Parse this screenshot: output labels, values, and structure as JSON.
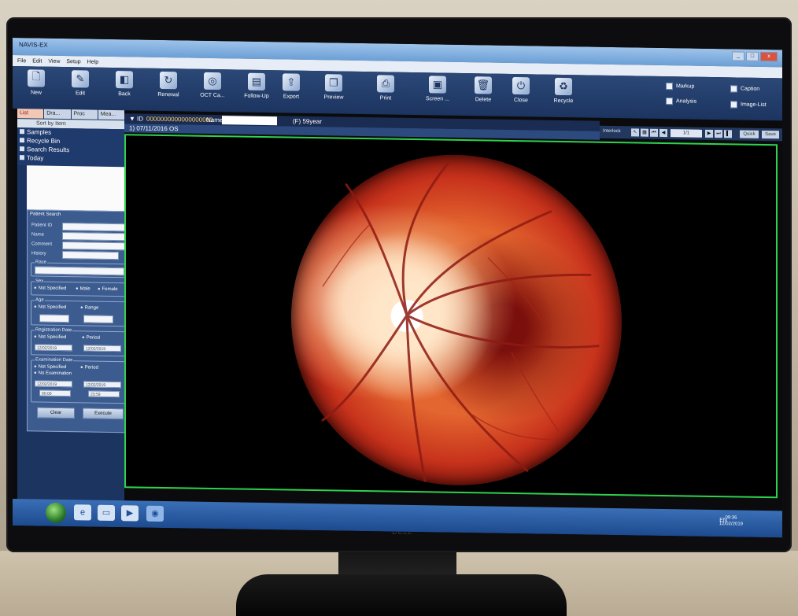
{
  "app": {
    "title": "NAVIS-EX"
  },
  "window_buttons": {
    "minimize": "_",
    "maximize": "□",
    "close": "x"
  },
  "menu": [
    "File",
    "Edit",
    "View",
    "Setup",
    "Help"
  ],
  "toolbar": [
    {
      "label": "New",
      "icon": "new-document-icon"
    },
    {
      "label": "Edit",
      "icon": "edit-icon"
    },
    {
      "label": "Back",
      "icon": "back-icon"
    },
    {
      "label": "Renewal",
      "icon": "renewal-icon"
    },
    {
      "label": "OCT Ca...",
      "icon": "oct-camera-icon"
    },
    {
      "label": "Follow-Up",
      "icon": "follow-up-icon"
    },
    {
      "label": "Export",
      "icon": "export-icon"
    },
    {
      "label": "Preview",
      "icon": "preview-icon"
    },
    {
      "label": "Print",
      "icon": "printer-icon"
    },
    {
      "label": "Screen ...",
      "icon": "screen-icon"
    },
    {
      "label": "Delete",
      "icon": "trash-icon"
    },
    {
      "label": "Close",
      "icon": "power-icon"
    },
    {
      "label": "Recycle",
      "icon": "recycle-icon"
    }
  ],
  "toolbar_options": [
    "Markup",
    "Caption",
    "Analysis",
    "Image-List"
  ],
  "sidebar": {
    "tabs": [
      "List",
      "Dra...",
      "Proc",
      "Mea..."
    ],
    "sort_label": "Sort by Item",
    "tree": [
      "Samples",
      "Recycle Bin",
      "Search Results",
      "Today"
    ]
  },
  "patient_search": {
    "title": "Patient Search",
    "fields": [
      "Patient ID",
      "Name",
      "Comment",
      "History"
    ],
    "race_label": "Race",
    "sex": {
      "label": "Sex",
      "options": [
        "Not Specified",
        "Male",
        "Female"
      ]
    },
    "age": {
      "label": "Age",
      "options": [
        "Not Specified",
        "Range"
      ]
    },
    "registration": {
      "label": "Registration Date",
      "options": [
        "Not Specified",
        "Period"
      ],
      "from": "12/02/2019",
      "to": "12/02/2019"
    },
    "examination": {
      "label": "Examination Date",
      "options": [
        "Not Specified",
        "Period",
        "No Examination"
      ],
      "from": "12/02/2019",
      "to": "12/02/2019",
      "time_from": "00:00",
      "time_to": "23:59"
    },
    "clear_label": "Clear",
    "execute_label": "Execute"
  },
  "record": {
    "id_prefix": "ID",
    "id_value": "0000000000000000000",
    "name_label": "Name",
    "sex_age": "(F) 59year",
    "date_eye": "1) 07/11/2016 OS"
  },
  "viewer_nav": {
    "interlock": "Interlock",
    "page": "1/1",
    "quick": "Quick",
    "save": "Save"
  },
  "taskbar": {
    "tray": "EN",
    "time": "09:36",
    "date": "12/02/2019"
  },
  "brand": "DELL"
}
